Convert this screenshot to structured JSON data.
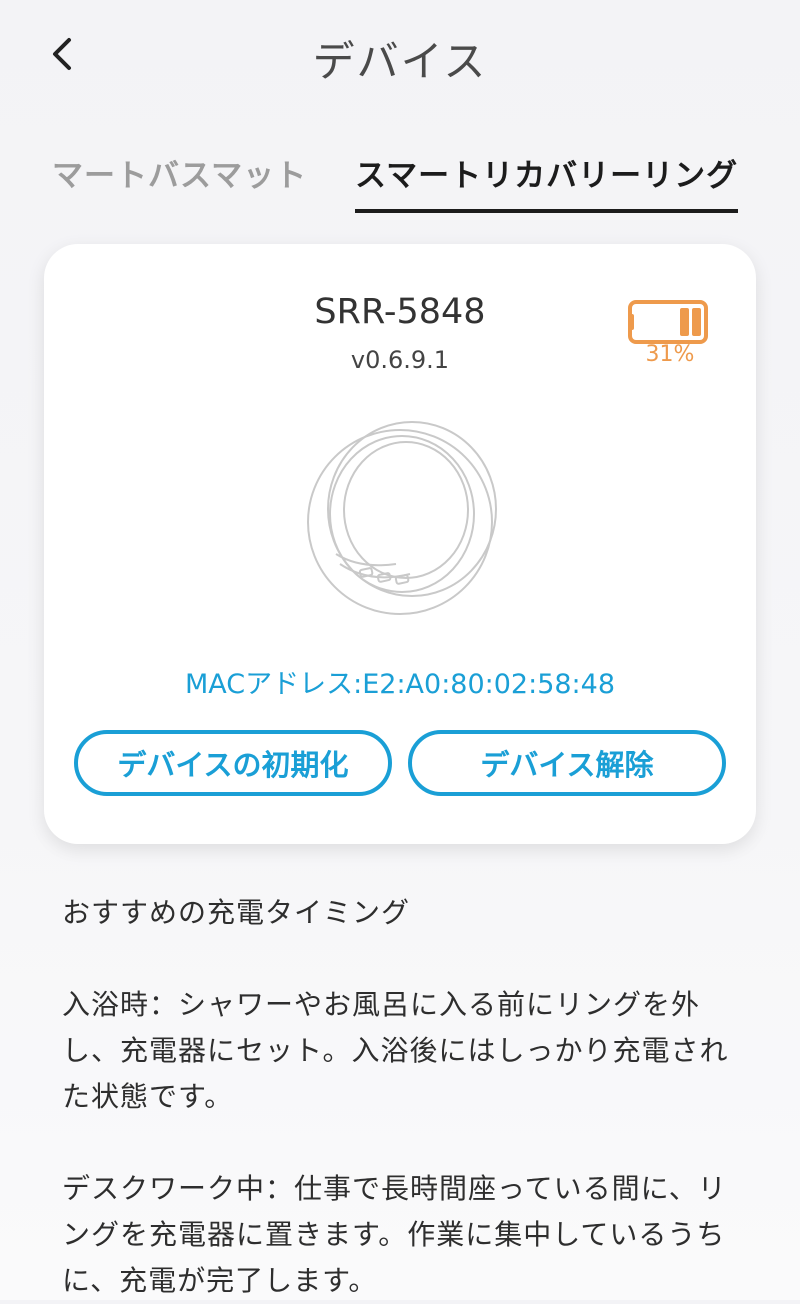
{
  "header": {
    "title": "デバイス"
  },
  "tabs": [
    {
      "label": "マートバスマット",
      "active": false
    },
    {
      "label": "スマートリカバリーリング",
      "active": true
    }
  ],
  "device": {
    "name": "SRR-5848",
    "version": "v0.6.9.1",
    "battery_percent_label": "31%",
    "battery_level": 0.31,
    "mac_label": "MACアドレス:E2:A0:80:02:58:48"
  },
  "buttons": {
    "reset_label": "デバイスの初期化",
    "unpair_label": "デバイス解除"
  },
  "info": {
    "heading": "おすすめの充電タイミング",
    "bath": "入浴時：シャワーやお風呂に入る前にリングを外し、充電器にセット。入浴後にはしっかり充電された状態です。",
    "desk": "デスクワーク中：仕事で長時間座っている間に、リングを充電器に置きます。作業に集中しているうちに、充電が完了します。"
  },
  "colors": {
    "accent": "#1a9fd6",
    "battery": "#ee9a4c",
    "active_tab": "#1c1c1c",
    "inactive_tab": "#9c9c9c"
  },
  "icons": {
    "back": "chevron-left-icon",
    "battery": "battery-icon",
    "ring": "smart-ring-image"
  }
}
